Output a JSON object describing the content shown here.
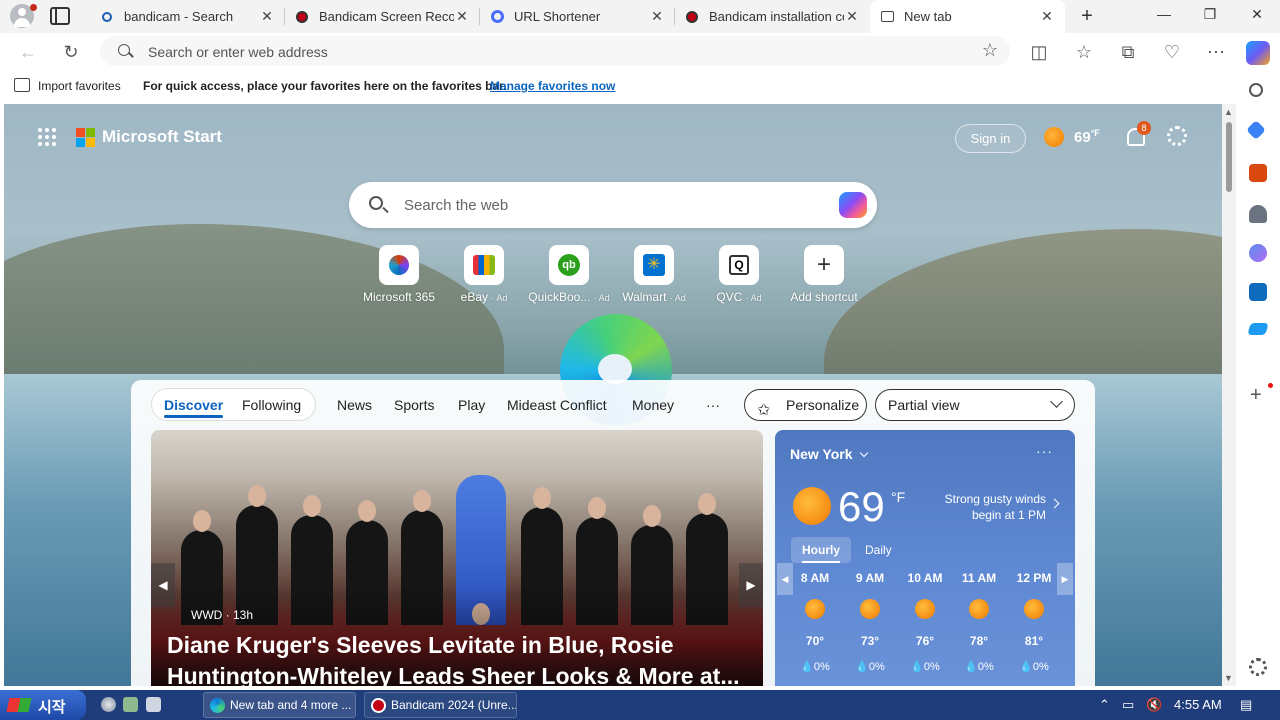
{
  "tabs": [
    {
      "title": "bandicam - Search",
      "icon": "search-icon"
    },
    {
      "title": "Bandicam Screen Recorder",
      "icon": "bandicam-icon"
    },
    {
      "title": "URL Shortener",
      "icon": "url-shortener-icon"
    },
    {
      "title": "Bandicam installation complete",
      "icon": "bandicam-icon"
    },
    {
      "title": "New tab",
      "icon": "new-tab-icon",
      "active": true
    }
  ],
  "address_bar": {
    "placeholder": "Search or enter web address"
  },
  "favorites_bar": {
    "import_label": "Import favorites",
    "hint": "For quick access, place your favorites here on the favorites bar.",
    "manage_link": "Manage favorites now"
  },
  "start_page": {
    "brand": "Microsoft Start",
    "sign_in": "Sign in",
    "header_temp": "69",
    "header_unit": "°F",
    "notification_count": "8",
    "search_placeholder": "Search the web",
    "shortcuts": [
      {
        "label": "Microsoft 365",
        "ad": ""
      },
      {
        "label": "eBay",
        "ad": "· Ad"
      },
      {
        "label": "QuickBoo...",
        "ad": "· Ad"
      },
      {
        "label": "Walmart",
        "ad": "· Ad"
      },
      {
        "label": "QVC",
        "ad": "· Ad"
      },
      {
        "label": "Add shortcut",
        "ad": ""
      }
    ]
  },
  "feed": {
    "tabs": [
      "Discover",
      "Following"
    ],
    "categories": [
      "News",
      "Sports",
      "Play",
      "Mideast Conflict",
      "Money"
    ],
    "more": "···",
    "personalize": "Personalize",
    "view_select": "Partial view",
    "hero": {
      "source": "WWD · 13h",
      "headline": "Diane Kruger's Sleeves Levitate in Blue, Rosie Huntington-Whiteley Leads Sheer Looks & More at..."
    }
  },
  "weather": {
    "city": "New York",
    "more": "···",
    "temp": "69",
    "unit": "°F",
    "alert": "Strong gusty winds begin at 1 PM",
    "tabs": [
      "Hourly",
      "Daily"
    ],
    "hours": [
      {
        "time": "8 AM",
        "temp": "70°",
        "precip": "0%"
      },
      {
        "time": "9 AM",
        "temp": "73°",
        "precip": "0%"
      },
      {
        "time": "10 AM",
        "temp": "76°",
        "precip": "0%"
      },
      {
        "time": "11 AM",
        "temp": "78°",
        "precip": "0%"
      },
      {
        "time": "12 PM",
        "temp": "81°",
        "precip": "0%"
      }
    ]
  },
  "taskbar": {
    "start": "시작",
    "items": [
      "New tab and 4 more ...",
      "Bandicam 2024 (Unre..."
    ],
    "clock": "4:55 AM"
  }
}
